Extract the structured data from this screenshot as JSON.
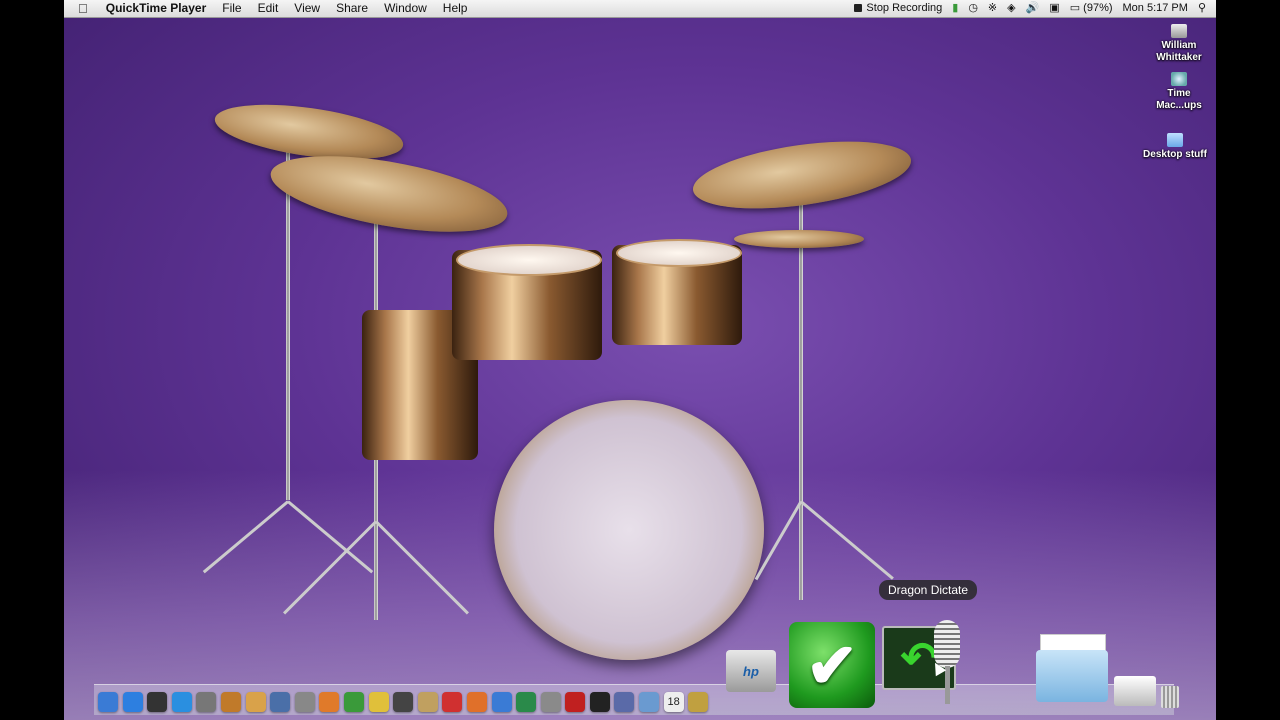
{
  "menubar": {
    "apple_icon": "apple-icon",
    "app_name": "QuickTime Player",
    "menus": [
      "File",
      "Edit",
      "View",
      "Share",
      "Window",
      "Help"
    ]
  },
  "status_bar": {
    "stop_recording": "Stop Recording",
    "battery": "(97%)",
    "clock": "Mon 5:17 PM",
    "icons": [
      "evernote-icon",
      "time-machine-icon",
      "bluetooth-icon",
      "wifi-icon",
      "volume-icon",
      "calendar-icon",
      "battery-icon",
      "spotlight-icon"
    ]
  },
  "desktop": {
    "icons": [
      {
        "label": "William Whittaker",
        "icon": "hard-drive-icon"
      },
      {
        "label": "Time Mac...ups",
        "icon": "time-machine-disk-icon"
      },
      {
        "label": "Desktop stuff",
        "icon": "folder-icon"
      }
    ],
    "wallpaper": "purple drum kit",
    "accent": "#5e3394"
  },
  "tooltip": {
    "label": "Dragon Dictate"
  },
  "dock": {
    "apps": [
      {
        "icon": "finder-icon",
        "color": "#3a7bd5"
      },
      {
        "icon": "app-store-icon",
        "color": "#2d7fe0"
      },
      {
        "icon": "dashboard-icon",
        "color": "#333333"
      },
      {
        "icon": "safari-icon",
        "color": "#2a8fe0"
      },
      {
        "icon": "system-preferences-icon",
        "color": "#777777"
      },
      {
        "icon": "garageband-icon",
        "color": "#c07a2a"
      },
      {
        "icon": "preview-icon",
        "color": "#d9a24a"
      },
      {
        "icon": "grid-app-icon",
        "color": "#4a6fa8"
      },
      {
        "icon": "hardware-icon",
        "color": "#888888"
      },
      {
        "icon": "ichat-icon",
        "color": "#e07a2a"
      },
      {
        "icon": "activity-icon",
        "color": "#3a9a3a"
      },
      {
        "icon": "pencil-icon",
        "color": "#e0c03a"
      },
      {
        "icon": "clapper-icon",
        "color": "#444444"
      },
      {
        "icon": "iphoto-icon",
        "color": "#c0a060"
      },
      {
        "icon": "itunes-icon",
        "color": "#d03030"
      },
      {
        "icon": "firefox-icon",
        "color": "#e0702a"
      },
      {
        "icon": "network-icon",
        "color": "#3a7bd5"
      },
      {
        "icon": "xcode-icon",
        "color": "#2a8a4a"
      },
      {
        "icon": "utility-icon",
        "color": "#8a8a8a"
      },
      {
        "icon": "acrobat-icon",
        "color": "#c02020"
      },
      {
        "icon": "blackberry-icon",
        "color": "#222222"
      },
      {
        "icon": "tools-icon",
        "color": "#5a6aa8"
      },
      {
        "icon": "photo-icon",
        "color": "#6a9ad0"
      },
      {
        "icon": "ical-icon",
        "color": "#eeeeee"
      },
      {
        "icon": "mail-stamp-icon",
        "color": "#c0a040"
      }
    ],
    "calendar_day": "18",
    "hp_label": "hp",
    "large_apps": [
      "hp-utility-icon",
      "checkmark-app-icon",
      "dragon-dictate-icon"
    ],
    "right_items": [
      "documents-stack-icon",
      "printer-icon",
      "trash-icon"
    ]
  }
}
